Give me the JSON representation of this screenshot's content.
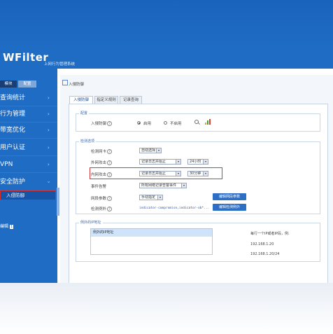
{
  "app": {
    "logo": "WFilter",
    "subtitle": "上网行为管理系统"
  },
  "sidebar": {
    "tabs": [
      "模块",
      "配置"
    ],
    "items": [
      {
        "label": "查询统计"
      },
      {
        "label": "行为管理"
      },
      {
        "label": "带宽优化"
      },
      {
        "label": "用户认证"
      },
      {
        "label": "VPN"
      },
      {
        "label": "安全防护"
      }
    ],
    "sub_item": "入侵防御",
    "bottom": {
      "label": "编辑",
      "badge": "1"
    },
    "chevron": "›"
  },
  "breadcrumb": {
    "text": "入侵防御"
  },
  "tabs": [
    "入侵防御",
    "指定义规则",
    "记录查询"
  ],
  "config": {
    "legend": "配置",
    "intrusion_label": "入侵防御",
    "enabled_label": "启用",
    "disabled_label": "不启用"
  },
  "detection": {
    "legend": "检测选项",
    "rows": [
      {
        "label": "检测网卡",
        "value": "自动选择"
      },
      {
        "label": "外网攻击",
        "value": "记录日志并阻止",
        "value2": "24小时"
      },
      {
        "label": "内网攻击",
        "value": "记录日志并阻止",
        "value2": "30分钟"
      },
      {
        "label": "事件告警",
        "value": "所有网络记录告警事件"
      },
      {
        "label": "网段参数",
        "value": "手动指定",
        "button": "编辑网段参数"
      },
      {
        "label": "检测例外",
        "value": "indicator-compromise,indicator-ob*...",
        "button": "编辑检测例外"
      }
    ]
  },
  "exceptions": {
    "legend": "例外的IP地址",
    "list_header": "例外的IP地址",
    "hint_title": "每行一个IP或者IP段，例:",
    "hint_lines": [
      "192.168.1.20",
      "192.168.1.20/24"
    ]
  },
  "colors": {
    "brand": "#1f6cc4",
    "highlight": "#d63a3a"
  },
  "icons": {
    "search": "search-icon",
    "chart": "chart-icon",
    "help": "help-icon"
  }
}
